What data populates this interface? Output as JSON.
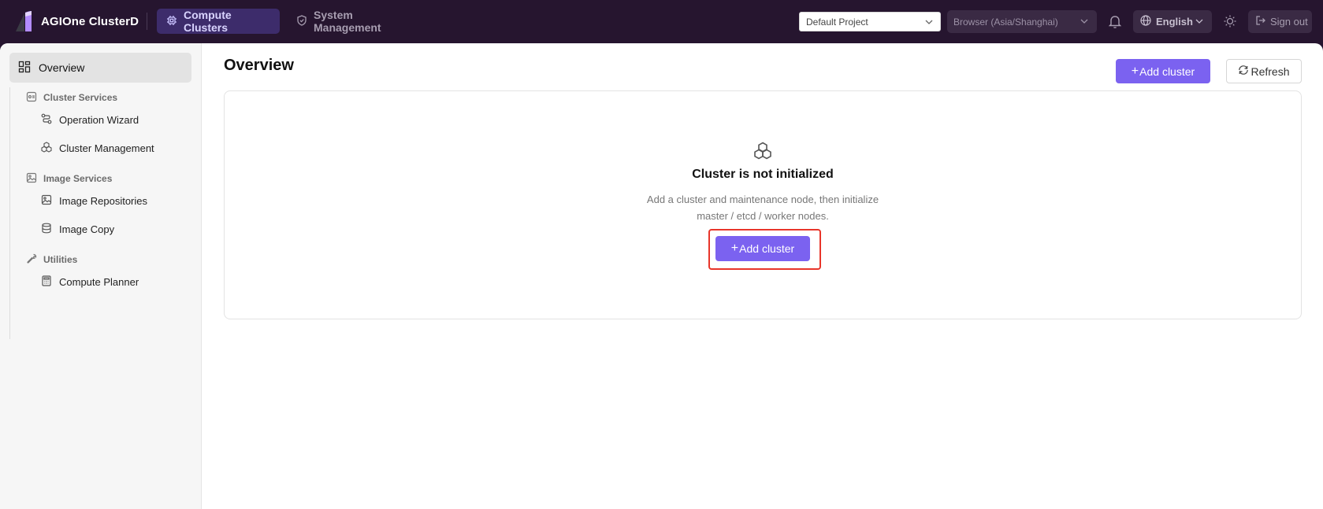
{
  "app": {
    "name": "AGIOne ClusterD"
  },
  "topnav": {
    "items": [
      {
        "label": "Compute Clusters",
        "active": true
      },
      {
        "label": "System Management",
        "active": false
      }
    ]
  },
  "header": {
    "project_select": {
      "value": "Default Project"
    },
    "timezone_select": {
      "value": "Browser (Asia/Shanghai)"
    },
    "language": {
      "label": "English"
    },
    "signout": {
      "label": "Sign out"
    }
  },
  "sidebar": {
    "overview": {
      "label": "Overview",
      "active": true
    },
    "groups": [
      {
        "label": "Cluster Services",
        "items": [
          {
            "label": "Operation Wizard"
          },
          {
            "label": "Cluster Management"
          }
        ]
      },
      {
        "label": "Image Services",
        "items": [
          {
            "label": "Image Repositories"
          },
          {
            "label": "Image Copy"
          }
        ]
      },
      {
        "label": "Utilities",
        "items": [
          {
            "label": "Compute Planner"
          }
        ]
      }
    ]
  },
  "main": {
    "title": "Overview",
    "add_cluster_label": "Add cluster",
    "refresh_label": "Refresh",
    "empty": {
      "title": "Cluster is not initialized",
      "description": "Add a cluster and maintenance node, then initialize master / etcd / worker nodes.",
      "button_label": "Add cluster"
    }
  },
  "colors": {
    "topbar_bg": "#26152f",
    "accent": "#7b62f0",
    "nav_active_bg": "#3d2c6b",
    "highlight": "#e8352a"
  }
}
